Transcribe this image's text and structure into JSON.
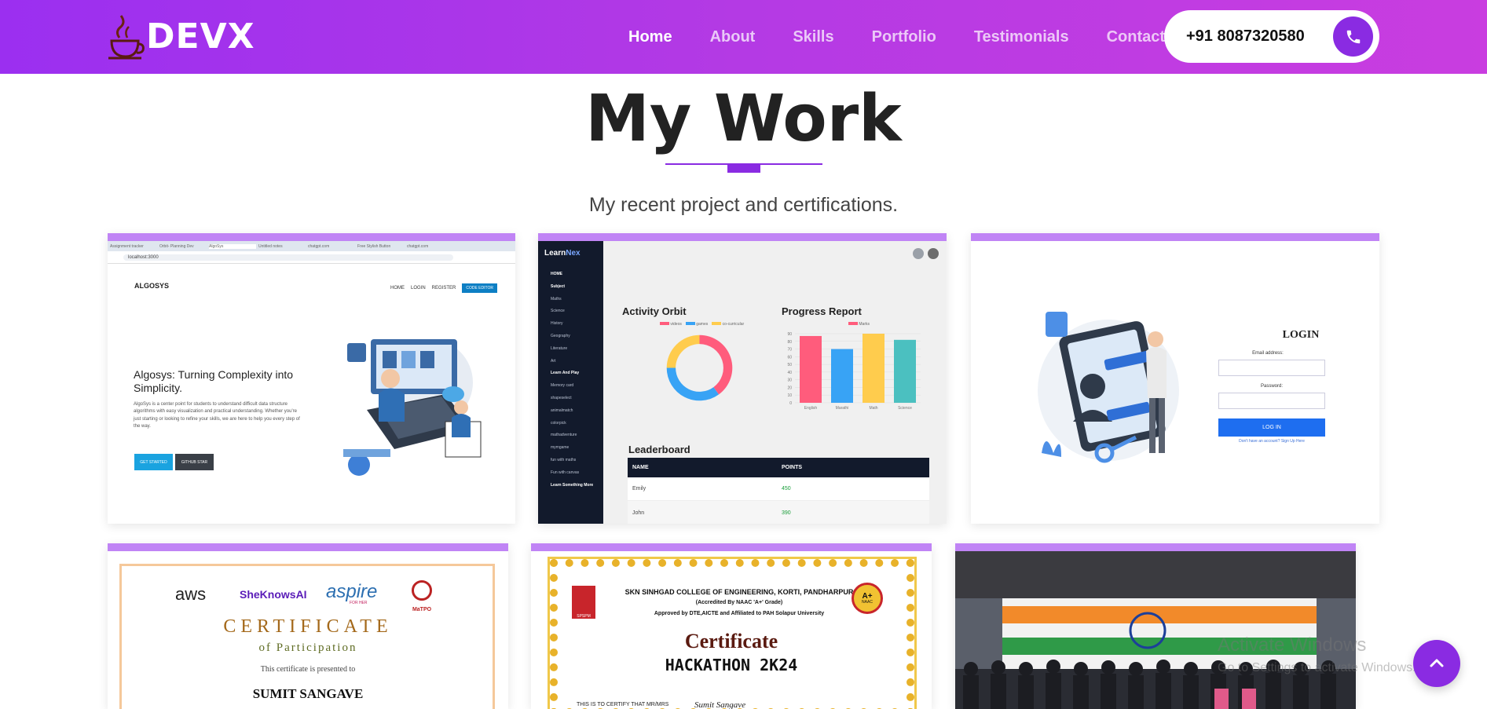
{
  "nav": {
    "logo_text": "DEVX",
    "items": [
      {
        "label": "Home",
        "active": true
      },
      {
        "label": "About"
      },
      {
        "label": "Skills"
      },
      {
        "label": "Portfolio"
      },
      {
        "label": "Testimonials"
      },
      {
        "label": "Contact"
      }
    ],
    "phone": "+91 8087320580"
  },
  "section": {
    "title": "My Work",
    "subtitle": "My recent project and certifications."
  },
  "cards": {
    "algosys": {
      "tabs": [
        "Assignment tracker",
        "Orbit- Planning Dev",
        "AlgoSys",
        "Untitled notes",
        "chatgpt.com",
        "Free Stylish Button",
        "chatgpt.com"
      ],
      "address": "localhost:3000",
      "brand": "ALGOSYS",
      "nav": [
        "HOME",
        "LOGIN",
        "REGISTER"
      ],
      "nav_button": "CODE EDITOR",
      "heading": "Algosys: Turning Complexity into Simplicity.",
      "body": "AlgoSys is a center point for students to understand difficult data structure algorithms with easy visualization and practical understanding. Whether you're just starting or looking to refine your skills, we are here to help you every step of the way.",
      "btn1": "GET STARTED",
      "btn2": "GITHUB STAR"
    },
    "learnnex": {
      "brand_a": "Learn",
      "brand_b": "Nex",
      "menu": [
        "HOME",
        "Subject",
        "Maths",
        "Science",
        "History",
        "Geography",
        "Literature",
        "Art",
        "Learn And Play",
        "Memory card",
        "shapeselect",
        "animalmatch",
        "colorpick",
        "mathadventure",
        "mymgame",
        "fun with maths",
        "Fun with canvas",
        "Learn Something More"
      ],
      "activity_title": "Activity Orbit",
      "activity_legend": [
        "videos",
        "games",
        "co-curricular"
      ],
      "progress_title": "Progress Report",
      "progress_legend": "Marks",
      "progress_bars": [
        {
          "label": "English",
          "value": 87,
          "color": "#ff5c7c"
        },
        {
          "label": "Marathi",
          "value": 70,
          "color": "#38a3f5"
        },
        {
          "label": "Math",
          "value": 90,
          "color": "#ffcc4d"
        },
        {
          "label": "Science",
          "value": 82,
          "color": "#4bc0c0"
        }
      ],
      "progress_ticks": [
        "90",
        "80",
        "70",
        "60",
        "50",
        "40",
        "30",
        "20",
        "10",
        "0"
      ],
      "donut": [
        {
          "name": "videos",
          "value": 40,
          "color": "#ff5c7c"
        },
        {
          "name": "games",
          "value": 35,
          "color": "#38a3f5"
        },
        {
          "name": "co-curricular",
          "value": 25,
          "color": "#ffcc4d"
        }
      ],
      "leaderboard_title": "Leaderboard",
      "lb_headers": [
        "NAME",
        "POINTS"
      ],
      "lb_rows": [
        {
          "name": "Emily",
          "points": "450"
        },
        {
          "name": "John",
          "points": "390"
        }
      ]
    },
    "login": {
      "title": "LOGIN",
      "email_label": "Email address:",
      "password_label": "Password:",
      "button": "LOG IN",
      "signup": "Don't have an account? Sign Up Here"
    },
    "cert1": {
      "logos": [
        "aws",
        "SheKnowsAI",
        "aspire",
        "MaTPO"
      ],
      "aspire_sub": "FOR HER",
      "title": "CERTIFICATE",
      "subtitle": "of Participation",
      "presented": "This certificate is presented to",
      "name": "SUMIT SANGAVE"
    },
    "cert2": {
      "college": "SKN SINHGAD COLLEGE OF ENGINEERING, KORTI, PANDHARPUR",
      "accredited": "(Accredited By NAAC 'A+' Grade)",
      "approved": "Approved by DTE,AICTE and Affiliated to PAH Solapur University",
      "badge_top": "A+",
      "badge_bottom": "NAAC",
      "seal_text": "SPSPM",
      "title": "Certificate",
      "event": "HACKATHON 2K24",
      "certify": "THIS IS TO CERTIFY THAT MR/MRS",
      "name": "Sumit Sangave"
    }
  },
  "watermark": {
    "line1": "Activate Windows",
    "line2": "Go to Settings to activate Windows."
  },
  "colors": {
    "accent": "#8a2be2",
    "nav_gradient_start": "#9b2ff0",
    "nav_gradient_end": "#c93de0",
    "card_top": "#c084f5"
  }
}
